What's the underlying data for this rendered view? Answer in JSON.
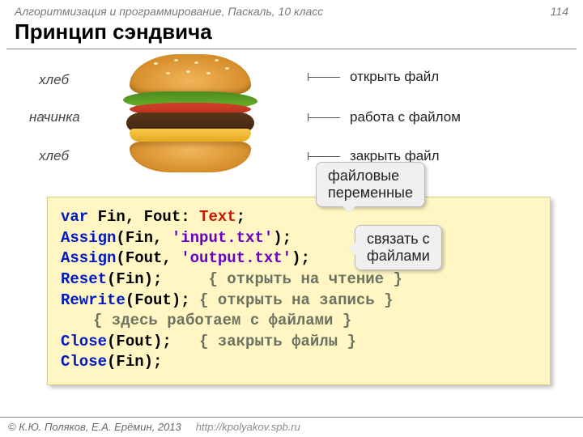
{
  "header": {
    "course": "Алгоритмизация и программирование, Паскаль, 10 класс",
    "page": "114"
  },
  "title": "Принцип сэндвича",
  "left_labels": {
    "top": "хлеб",
    "mid": "начинка",
    "bot": "хлеб"
  },
  "right_labels": {
    "open": "открыть файл",
    "work": "работа с  файлом",
    "close": "закрыть файл"
  },
  "callouts": {
    "vars": "файловые\nпеременные",
    "assign": "связать с\nфайлами"
  },
  "code": {
    "l1": {
      "a": "var",
      "b": " Fin, Fout: ",
      "c": "Text",
      "d": ";"
    },
    "l2": {
      "a": "Assign",
      "b": "(Fin, ",
      "c": "'input.txt'",
      "d": ");"
    },
    "l3": {
      "a": "Assign",
      "b": "(Fout, ",
      "c": "'output.txt'",
      "d": ");"
    },
    "l4": {
      "a": "Reset",
      "b": "(Fin);     ",
      "c": "{ открыть на чтение }"
    },
    "l5": {
      "a": "Rewrite",
      "b": "(Fout); ",
      "c": "{ открыть на запись }"
    },
    "l6": {
      "a": "{ здесь работаем с файлами }"
    },
    "l7": {
      "a": "Close",
      "b": "(Fout);   ",
      "c": "{ закрыть файлы }"
    },
    "l8": {
      "a": "Close",
      "b": "(Fin);"
    }
  },
  "footer": {
    "copy": "© К.Ю. Поляков, Е.А. Ерёмин, 2013",
    "url": "http://kpolyakov.spb.ru"
  }
}
